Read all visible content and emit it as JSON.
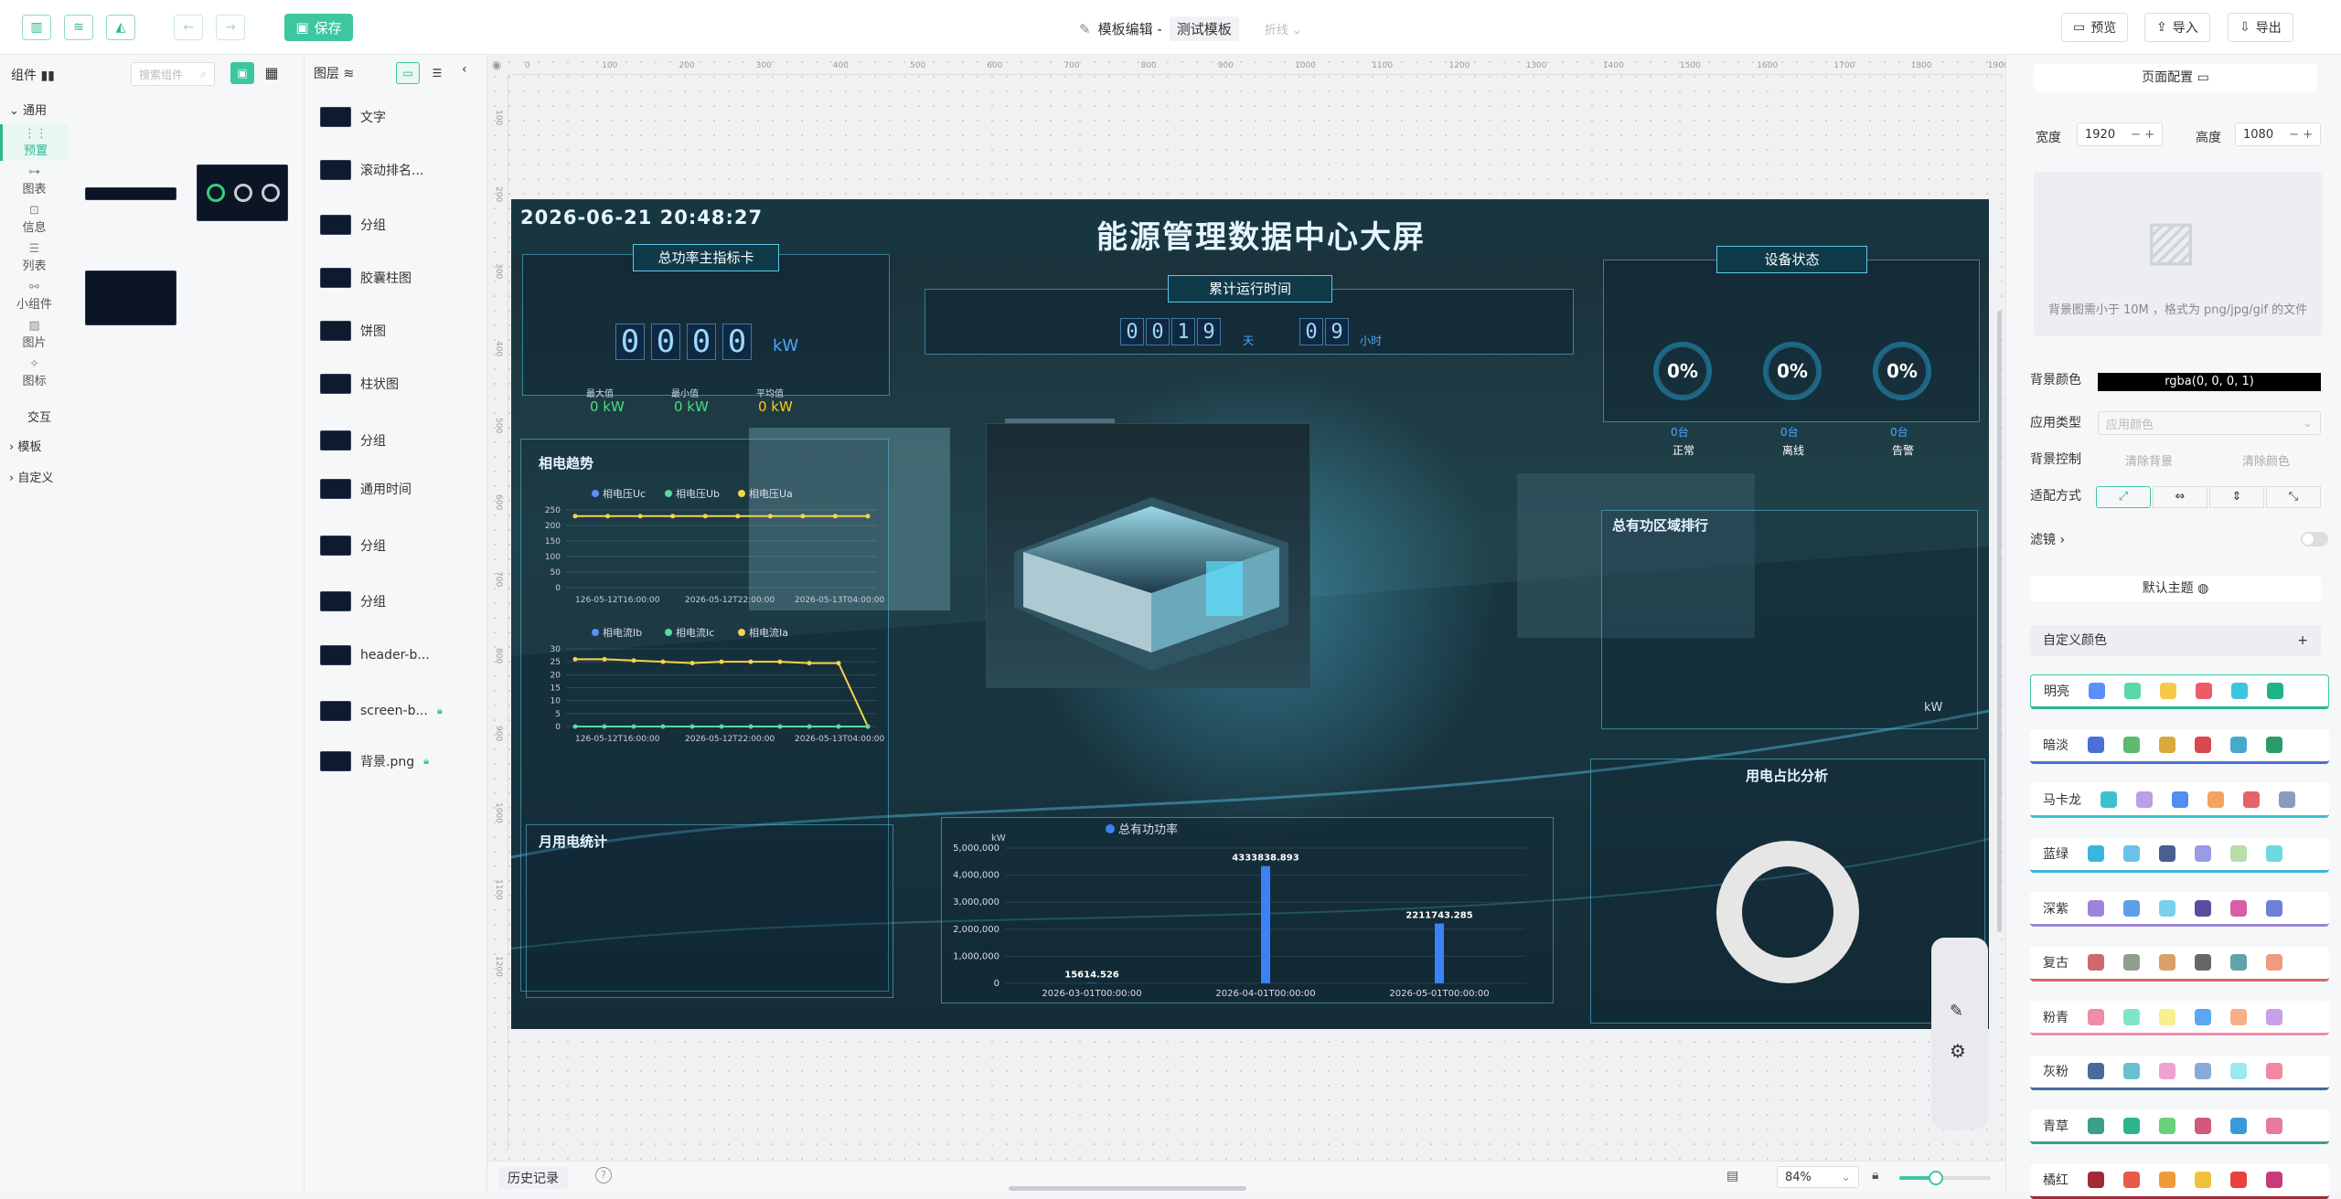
{
  "app": {
    "breadcrumb_prefix": "模板编辑 -",
    "template_name": "测试模板",
    "collapse_label": "折线",
    "save_label": "保存"
  },
  "topbar": {
    "preview": "预览",
    "import": "导入",
    "export": "导出"
  },
  "components": {
    "title": "组件",
    "search_placeholder": "搜索组件",
    "common": "通用",
    "categories": [
      "预置",
      "图表",
      "信息",
      "列表",
      "小组件",
      "图片",
      "图标"
    ],
    "interaction": "交互",
    "template": "模板",
    "custom": "自定义"
  },
  "layers": {
    "title": "图层",
    "items": [
      {
        "label": "文字"
      },
      {
        "label": "滚动排名..."
      },
      {
        "label": "分组"
      },
      {
        "label": "胶囊柱图"
      },
      {
        "label": "饼图"
      },
      {
        "label": "柱状图"
      },
      {
        "label": "分组"
      },
      {
        "label": "通用时间"
      },
      {
        "label": "分组"
      },
      {
        "label": "分组"
      },
      {
        "label": "header-b..."
      },
      {
        "label": "screen-b..."
      },
      {
        "label": "背景.png"
      }
    ]
  },
  "screen": {
    "datetime": "2026-06-21 20:48:27",
    "main_title": "能源管理数据中心大屏",
    "power_card": {
      "title": "总功率主指标卡",
      "digits": [
        "0",
        "0",
        "0",
        "0"
      ],
      "unit": "kW",
      "stats": [
        {
          "label": "最大值",
          "value": "0 kW"
        },
        {
          "label": "最小值",
          "value": "0 kW"
        },
        {
          "label": "平均值",
          "value": "0 kW"
        }
      ]
    },
    "runtime": {
      "title": "累计运行时间",
      "days": [
        "0",
        "0",
        "1",
        "9"
      ],
      "day_unit": "天",
      "hours": [
        "0",
        "9"
      ],
      "hour_unit": "小时"
    },
    "device": {
      "title": "设备状态",
      "items": [
        {
          "pct": "0%",
          "value": "0台",
          "label": "正常"
        },
        {
          "pct": "0%",
          "value": "0台",
          "label": "离线"
        },
        {
          "pct": "0%",
          "value": "0台",
          "label": "告警"
        }
      ]
    },
    "trend_title": "相电趋势",
    "region_title": "总有功区域排行",
    "region_unit": "kW",
    "monthly_title": "月用电统计",
    "ratio_title": "用电占比分析"
  },
  "chart_data": [
    {
      "type": "line",
      "legend": [
        "相电压Uc",
        "相电压Ub",
        "相电压Ua"
      ],
      "x": [
        "126-05-12T16:00:00",
        "2026-05-12T22:00:00",
        "2026-05-13T04:00:00"
      ],
      "yticks": [
        "0",
        "50",
        "100",
        "150",
        "200",
        "250"
      ],
      "ylim": [
        0,
        250
      ],
      "series": [
        {
          "name": "相电压Uc",
          "values": [
            230,
            230,
            230,
            230,
            230,
            230,
            230,
            230,
            230,
            230
          ]
        }
      ],
      "colors": [
        "#5b8ff9",
        "#5ad8a6",
        "#f6d34b"
      ]
    },
    {
      "type": "line",
      "legend": [
        "相电流Ib",
        "相电流Ic",
        "相电流Ia"
      ],
      "x": [
        "126-05-12T16:00:00",
        "2026-05-12T22:00:00",
        "2026-05-13T04:00:00"
      ],
      "yticks": [
        "0",
        "5",
        "10",
        "15",
        "20",
        "25",
        "30"
      ],
      "ylim": [
        0,
        30
      ],
      "series": [
        {
          "name": "相电流Ia",
          "values": [
            26,
            26,
            25.5,
            25,
            24.5,
            25,
            25,
            25,
            24.5,
            24.5,
            0
          ]
        },
        {
          "name": "相电流Ib",
          "values": [
            0,
            0,
            0,
            0,
            0,
            0,
            0,
            0,
            0,
            0,
            0
          ]
        }
      ]
    },
    {
      "type": "bar",
      "legend": [
        "总有功功率"
      ],
      "ylabel": "kW",
      "categories": [
        "2026-03-01T00:00:00",
        "2026-04-01T00:00:00",
        "2026-05-01T00:00:00"
      ],
      "values": [
        15614.526,
        4333838.893,
        2211743.285
      ],
      "labels": [
        "15614.526",
        "4333838.893",
        "2211743.285"
      ],
      "yticks": [
        "0",
        "1,000,000",
        "2,000,000",
        "3,000,000",
        "4,000,000",
        "5,000,000"
      ],
      "ylim": [
        0,
        5000000
      ],
      "color": "#3b82f6"
    }
  ],
  "config": {
    "title": "页面配置",
    "width_label": "宽度",
    "width": "1920",
    "height_label": "高度",
    "height": "1080",
    "bg_hint": "背景图需小于 10M ，格式为 png/jpg/gif 的文件",
    "bg_color_label": "背景颜色",
    "bg_color": "rgba(0, 0, 0, 1)",
    "app_type_label": "应用类型",
    "app_type_placeholder": "应用颜色",
    "bg_ctrl_label": "背景控制",
    "clear_bg": "清除背景",
    "clear_color": "清除颜色",
    "fit_label": "适配方式",
    "filter_label": "滤镜",
    "default_theme": "默认主题",
    "custom_color": "自定义颜色",
    "themes": [
      {
        "name": "明亮",
        "colors": [
          "#5b8ff9",
          "#5ad8a6",
          "#f6c94b",
          "#ef5a6b",
          "#3bc5e0",
          "#1fb38b"
        ],
        "bar": "#2cb58e"
      },
      {
        "name": "暗淡",
        "colors": [
          "#4a6fd8",
          "#5dba6e",
          "#d9a93a",
          "#d8484e",
          "#48a9cf",
          "#2a9c6a"
        ],
        "bar": "#4a6fd8"
      },
      {
        "name": "马卡龙",
        "colors": [
          "#3bc3cc",
          "#b8a1e6",
          "#4e8ff0",
          "#f6a25f",
          "#e6626a",
          "#8c9abf"
        ],
        "bar": "#3bc3cc"
      },
      {
        "name": "蓝绿",
        "colors": [
          "#3ab5e0",
          "#6ec0e8",
          "#4b5e8f",
          "#9a9ae6",
          "#b6e0a8",
          "#6fd8e0"
        ],
        "bar": "#3ab5e0"
      },
      {
        "name": "深紫",
        "colors": [
          "#9b85d8",
          "#5ea0e8",
          "#7ad0e8",
          "#5b4d9e",
          "#d65fa8",
          "#6f7fd8"
        ],
        "bar": "#9b85d8"
      },
      {
        "name": "复古",
        "colors": [
          "#cf6a6a",
          "#8ea08c",
          "#d9a06a",
          "#666",
          "#60a3a8",
          "#f09a80"
        ],
        "bar": "#cf6a6a"
      },
      {
        "name": "粉青",
        "colors": [
          "#f08ba8",
          "#7ee6c8",
          "#f8f08a",
          "#5aa8f0",
          "#f5b08a",
          "#c8a0e8"
        ],
        "bar": "#f08ba8"
      },
      {
        "name": "灰粉",
        "colors": [
          "#4a6a9a",
          "#6ac0d0",
          "#f0a0d0",
          "#8aaad8",
          "#9ae8f0",
          "#f08aa0"
        ],
        "bar": "#4a6a9a"
      },
      {
        "name": "青草",
        "colors": [
          "#3aa08a",
          "#2cb58e",
          "#6ad07a",
          "#d05a78",
          "#3a9ad8",
          "#e87aa0"
        ],
        "bar": "#3aa08a"
      },
      {
        "name": "橘红",
        "colors": [
          "#a02a3a",
          "#e85a4a",
          "#f09a3a",
          "#f0c03a",
          "#e8403a",
          "#c83a7a"
        ],
        "bar": "#a02a3a"
      }
    ]
  },
  "bottom": {
    "history": "历史记录",
    "zoom": "84%"
  },
  "ruler": {
    "h": [
      "0",
      "100",
      "200",
      "300",
      "400",
      "500",
      "600",
      "700",
      "800",
      "900",
      "1000",
      "1100",
      "1200",
      "1300",
      "1400",
      "1500",
      "1600",
      "1700",
      "1800",
      "1900"
    ],
    "v": [
      "100",
      "200",
      "300",
      "400",
      "500",
      "600",
      "700",
      "800",
      "900",
      "1000",
      "1100",
      "1200"
    ]
  }
}
